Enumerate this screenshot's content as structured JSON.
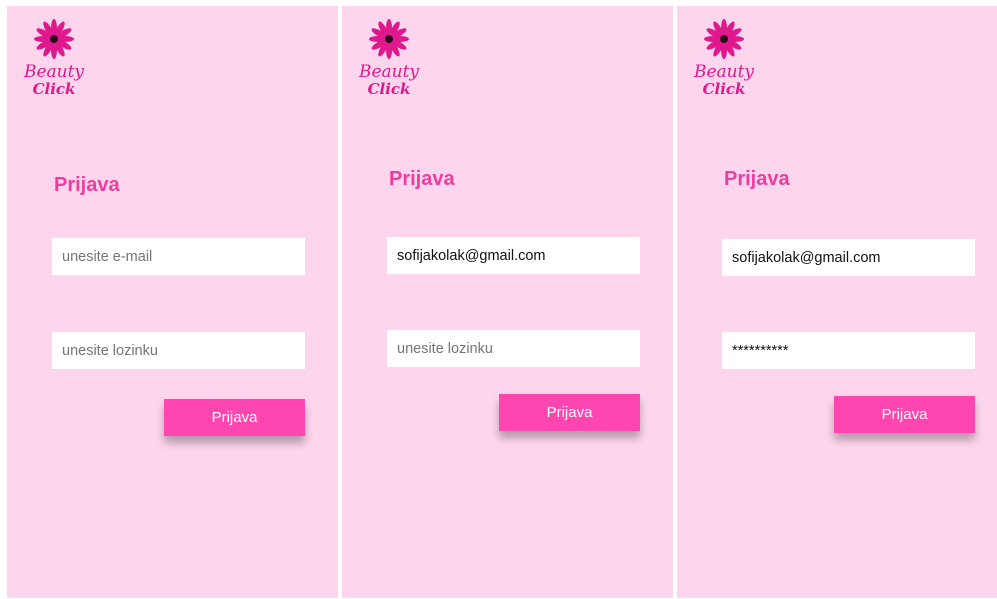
{
  "app": {
    "logo_line1": "Beauty",
    "logo_line2": "Click"
  },
  "colors": {
    "background": "#fdd5ec",
    "accent": "#ff45b0",
    "title": "#ee3d9f",
    "logo": "#e0188d"
  },
  "screens": [
    {
      "title": "Prijava",
      "email": {
        "placeholder": "unesite e-mail",
        "value": ""
      },
      "password": {
        "placeholder": "unesite lozinku",
        "value": ""
      },
      "button_label": "Prijava"
    },
    {
      "title": "Prijava",
      "email": {
        "placeholder": "unesite e-mail",
        "value": "sofijakolak@gmail.com"
      },
      "password": {
        "placeholder": "unesite lozinku",
        "value": ""
      },
      "button_label": "Prijava"
    },
    {
      "title": "Prijava",
      "email": {
        "placeholder": "unesite e-mail",
        "value": "sofijakolak@gmail.com"
      },
      "password": {
        "placeholder": "unesite lozinku",
        "value": "**********"
      },
      "button_label": "Prijava"
    }
  ]
}
